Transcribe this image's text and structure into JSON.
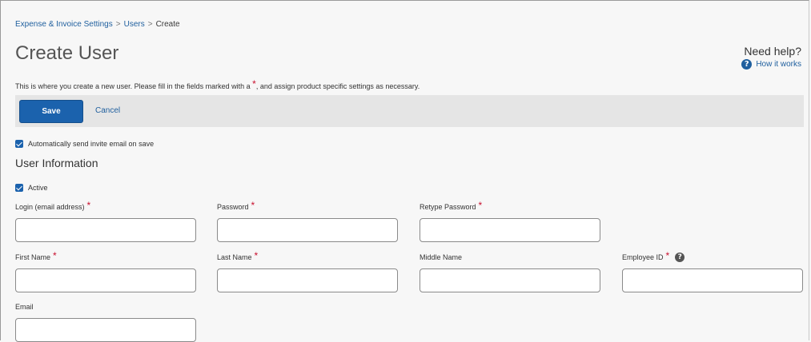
{
  "breadcrumb": {
    "items": [
      "Expense & Invoice Settings",
      "Users"
    ],
    "current": "Create",
    "separator": ">"
  },
  "page": {
    "title": "Create User",
    "intro_before": "This is where you create a new user. Please fill in the fields marked with a ",
    "intro_marker": "*",
    "intro_after": ", and assign product specific settings as necessary."
  },
  "help": {
    "title": "Need help?",
    "link": "How it works",
    "icon": "question-circle-icon"
  },
  "toolbar": {
    "save_label": "Save",
    "cancel_label": "Cancel"
  },
  "invite": {
    "label": "Automatically send invite email on save",
    "checked": true
  },
  "user_info": {
    "title": "User Information",
    "active_label": "Active",
    "active_checked": true
  },
  "fields": {
    "login": {
      "label": "Login (email address)",
      "required": "*",
      "value": ""
    },
    "password": {
      "label": "Password",
      "required": "*",
      "value": ""
    },
    "retype_password": {
      "label": "Retype Password",
      "required": "*",
      "value": ""
    },
    "first_name": {
      "label": "First Name",
      "required": "*",
      "value": ""
    },
    "last_name": {
      "label": "Last Name",
      "required": "*",
      "value": ""
    },
    "middle_name": {
      "label": "Middle Name",
      "value": ""
    },
    "employee_id": {
      "label": "Employee ID",
      "required": "*",
      "help_icon": "?",
      "value": ""
    },
    "email": {
      "label": "Email",
      "value": ""
    }
  },
  "colors": {
    "primary": "#1b62ad",
    "link": "#1f5f9e",
    "required": "#c8102e",
    "toolbar_bg": "#e5e5e5",
    "page_bg": "#f7f7f7"
  }
}
